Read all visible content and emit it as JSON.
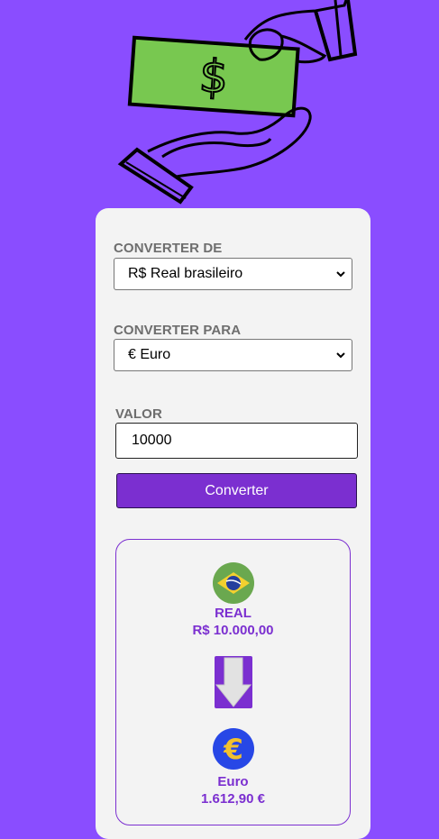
{
  "form": {
    "from_label": "CONVERTER DE",
    "from_selected": "R$ Real brasileiro",
    "to_label": "CONVERTER PARA",
    "to_selected": "€ Euro",
    "amount_label": "VALOR",
    "amount_value": "10000",
    "convert_button": "Converter"
  },
  "result": {
    "source_currency": "REAL",
    "source_amount": "R$ 10.000,00",
    "target_currency": "Euro",
    "target_amount": "1.612,90 €"
  },
  "colors": {
    "background": "#8a4dff",
    "accent": "#7b2fd0",
    "card": "#f3f3f3",
    "money": "#78c850"
  },
  "icons": {
    "hero": "hand-giving-money-icon",
    "source": "brazil-flag-icon",
    "arrow": "arrow-down-icon",
    "target": "euro-icon"
  }
}
